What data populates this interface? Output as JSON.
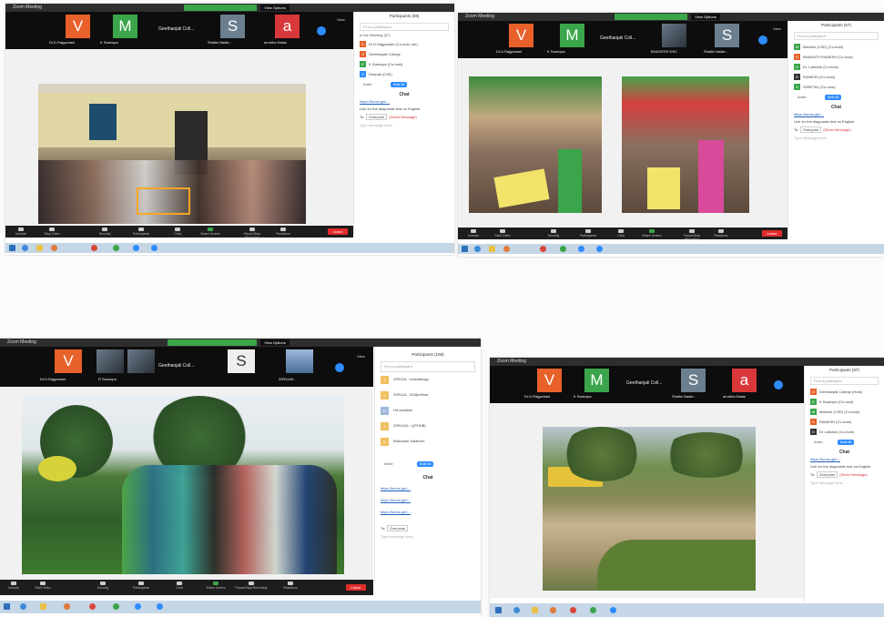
{
  "screenshots": [
    {
      "app_title": "Zoom Meeting",
      "banner": "",
      "view_options": "View Options",
      "view_label": "View",
      "meeting_title": "Geethanjali Coll...",
      "tiles": [
        {
          "letter": "V",
          "color": "#e8612a",
          "name": "Dr.D.Rajgamani"
        },
        {
          "letter": "M",
          "color": "#3aa54a",
          "name": "K Swarupa"
        },
        {
          "letter": "S",
          "color": "#6b7f8e",
          "name": "Shalini Nalab..."
        },
        {
          "letter": "a",
          "color": "#d9383b",
          "name": "aruntha Nalas"
        }
      ],
      "panel": {
        "title": "Participants (59)",
        "find": "Find a participant",
        "section": "In the Meeting (57)",
        "participants": [
          {
            "letter": "D",
            "color": "#e8612a",
            "name": "Dr.D.Rajgamani (Co-host, me)"
          },
          {
            "letter": "G",
            "color": "#e8612a",
            "name": "Geethanjali College"
          },
          {
            "letter": "K",
            "color": "#3aa54a",
            "name": "K Swarupa (Co-host)"
          },
          {
            "letter": "S",
            "color": "#2d8cff",
            "name": "Deepak (CSE)"
          }
        ],
        "invite": "Invite",
        "invite_btn": "Mute All",
        "chat_title": "Chat",
        "chat_links": [
          "https://forms.gle/..."
        ],
        "chat_msg": "Link for the diagnostic test on English",
        "to_label": "To:",
        "to_value": "Everyone",
        "to_extra": "(Direct Message)",
        "type_msg": "Type message here..."
      },
      "controls": [
        "Unmute",
        "Stop Video",
        "Security",
        "Participants",
        "Chat",
        "Share Screen",
        "Pause/Stop Recording",
        "Reactions"
      ],
      "leave": "Leave"
    },
    {
      "app_title": "Zoom Meeting",
      "banner": "",
      "view_options": "View Options",
      "view_label": "View",
      "meeting_title": "Geethanjali Coll...",
      "tiles": [
        {
          "letter": "V",
          "color": "#e8612a",
          "name": "Dr.D.Rajgamani"
        },
        {
          "letter": "M",
          "color": "#3aa54a",
          "name": "K Swarupa"
        },
        {
          "letter": "",
          "color": "#333333",
          "name": "BHAGESH DSC"
        },
        {
          "letter": "S",
          "color": "#6b7f8e",
          "name": "Shalini Nalab..."
        }
      ],
      "panel": {
        "title": "Participants (57)",
        "find": "Find a participant",
        "section": "",
        "participants": [
          {
            "letter": "M",
            "color": "#3aa54a",
            "name": "Mahesh (CSE) (Co-host)"
          },
          {
            "letter": "B",
            "color": "#e8612a",
            "name": "BHARATH RAMESH (Co-host)"
          },
          {
            "letter": "D",
            "color": "#3aa54a",
            "name": "Dr. Lakshmi (Co-host)"
          },
          {
            "letter": "R",
            "color": "#333333",
            "name": "RAMESH (Co-host)"
          },
          {
            "letter": "S",
            "color": "#3aa54a",
            "name": "SHEETAL (Co-host)"
          }
        ],
        "invite": "Invite",
        "invite_btn": "Mute All",
        "chat_title": "Chat",
        "chat_links": [
          "https://forms.gle/..."
        ],
        "chat_msg": "Link for the diagnostic test on English",
        "to_label": "To:",
        "to_value": "Everyone",
        "to_extra": "(Direct Message)",
        "type_msg": "Type message here..."
      },
      "controls": [
        "Unmute",
        "Start Video",
        "Security",
        "Participants",
        "Chat",
        "Share Screen",
        "Pause/Stop Recording",
        "Reactions"
      ],
      "leave": "Leave"
    },
    {
      "app_title": "Zoom Meeting",
      "banner": "",
      "view_options": "View Options",
      "view_label": "View",
      "meeting_title": "Geethanjali Coll...",
      "tiles": [
        {
          "letter": "V",
          "color": "#e8612a",
          "name": "Dr.D.Rajgamani"
        },
        {
          "letter": "",
          "color": "#444444",
          "name": "R Swarupa"
        },
        {
          "letter": "",
          "color": "#444444",
          "name": ""
        },
        {
          "letter": "S",
          "color": "#6b7f8e",
          "name": ""
        },
        {
          "letter": "",
          "color": "#4b6e9a",
          "name": "20R11A0..."
        }
      ],
      "panel": {
        "title": "Participants (169)",
        "find": "Find a participant",
        "section": "",
        "participants": [
          {
            "letter": "2",
            "color": "#f0c060",
            "name": "20R11A...hinisubbagu"
          },
          {
            "letter": "2",
            "color": "#f0c060",
            "name": "20R11A...2018pelima"
          },
          {
            "letter": "H",
            "color": "#9db8d9",
            "name": "Hd subaksh"
          },
          {
            "letter": "2",
            "color": "#f0c060",
            "name": "20R11A0...1(PHHB)"
          },
          {
            "letter": "B",
            "color": "#f0c060",
            "name": "Brahmam Kalaburh"
          }
        ],
        "invite": "Invite",
        "invite_btn": "Mute All",
        "chat_title": "Chat",
        "chat_links": [
          "https://forms.gle/...",
          "https://forms.gle/...",
          "https://forms.gle/..."
        ],
        "chat_msg": "",
        "to_label": "To:",
        "to_value": "Everyone",
        "to_extra": "",
        "type_msg": "Type message here..."
      },
      "controls": [
        "Unmute",
        "Start Video",
        "Security",
        "Participants",
        "Chat",
        "Share Screen",
        "Pause/Stop Recording",
        "Reactions"
      ],
      "leave": "Leave"
    },
    {
      "app_title": "Zoom Meeting",
      "banner": "",
      "view_options": "",
      "view_label": "",
      "meeting_title": "Geethanjali Coll...",
      "tiles": [
        {
          "letter": "V",
          "color": "#e8612a",
          "name": "Dr.D.Rajgamani"
        },
        {
          "letter": "M",
          "color": "#3aa54a",
          "name": "K Swarupa"
        },
        {
          "letter": "S",
          "color": "#6b7f8e",
          "name": "Shalini Nalab..."
        },
        {
          "letter": "a",
          "color": "#d9383b",
          "name": "aruntha Nalas"
        }
      ],
      "panel": {
        "title": "Participants (87)",
        "find": "Find a participant",
        "section": "",
        "participants": [
          {
            "letter": "G",
            "color": "#e8612a",
            "name": "Geethanjali College (Host)"
          },
          {
            "letter": "K",
            "color": "#3aa54a",
            "name": "K Swarupa (Co-host)"
          },
          {
            "letter": "M",
            "color": "#3aa54a",
            "name": "Mahesh (CSE) (Co-host)"
          },
          {
            "letter": "R",
            "color": "#e8612a",
            "name": "RAMESH (Co-host)"
          },
          {
            "letter": "D",
            "color": "#333333",
            "name": "Dr Lakshmi (Co-host)"
          }
        ],
        "invite": "Invite",
        "invite_btn": "Mute All",
        "chat_title": "Chat",
        "chat_links": [
          "https://forms.gle/..."
        ],
        "chat_msg": "Link for the diagnostic test on English",
        "to_label": "To:",
        "to_value": "Everyone",
        "to_extra": "(Direct Message)",
        "type_msg": "Type message here..."
      },
      "controls": [],
      "leave": ""
    }
  ]
}
